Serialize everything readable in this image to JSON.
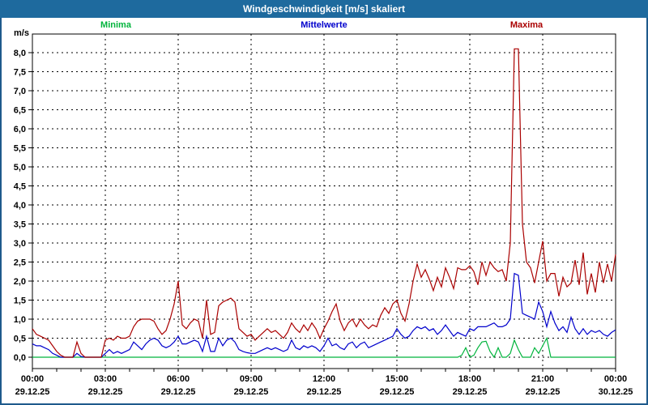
{
  "window": {
    "title": "Windgeschwindigkeit [m/s] skaliert"
  },
  "chart_data": {
    "type": "line",
    "title": "Windgeschwindigkeit [m/s] skaliert",
    "y_unit": "m/s",
    "x_interval_minutes": 10,
    "x_range_hours": [
      0,
      24
    ],
    "ylim": [
      -0.3,
      8.5
    ],
    "y_tick_step": 0.5,
    "grid": true,
    "legend_position": "top",
    "y_tick_labels": [
      "0,0",
      "0,5",
      "1,0",
      "1,5",
      "2,0",
      "2,5",
      "3,0",
      "3,5",
      "4,0",
      "4,5",
      "5,0",
      "5,5",
      "6,0",
      "6,5",
      "7,0",
      "7,5",
      "8,0"
    ],
    "x_ticks": [
      {
        "time": "00:00",
        "date": "29.12.25"
      },
      {
        "time": "03:00",
        "date": "29.12.25"
      },
      {
        "time": "06:00",
        "date": "29.12.25"
      },
      {
        "time": "09:00",
        "date": "29.12.25"
      },
      {
        "time": "12:00",
        "date": "29.12.25"
      },
      {
        "time": "15:00",
        "date": "29.12.25"
      },
      {
        "time": "18:00",
        "date": "29.12.25"
      },
      {
        "time": "21:00",
        "date": "29.12.25"
      },
      {
        "time": "00:00",
        "date": "30.12.25"
      }
    ],
    "series": [
      {
        "name": "Minima",
        "color": "#00b43c",
        "values": [
          0,
          0,
          0,
          0,
          0,
          0,
          0,
          0,
          0,
          0,
          0,
          0,
          0,
          0,
          0,
          0,
          0,
          0,
          0,
          0,
          0,
          0,
          0,
          0,
          0,
          0,
          0,
          0,
          0,
          0,
          0,
          0,
          0,
          0,
          0,
          0,
          0,
          0,
          0,
          0,
          0,
          0,
          0,
          0,
          0,
          0,
          0,
          0,
          0,
          0,
          0,
          0,
          0,
          0,
          0,
          0,
          0,
          0,
          0,
          0,
          0,
          0,
          0,
          0,
          0,
          0,
          0,
          0,
          0,
          0,
          0,
          0,
          0,
          0,
          0,
          0,
          0,
          0,
          0,
          0,
          0,
          0,
          0,
          0,
          0,
          0,
          0,
          0,
          0,
          0,
          0,
          0,
          0,
          0,
          0,
          0,
          0,
          0,
          0,
          0,
          0,
          0,
          0,
          0,
          0,
          0,
          0.05,
          0.25,
          0,
          0.05,
          0.25,
          0.4,
          0.42,
          0.15,
          0,
          0.25,
          0,
          0,
          0.1,
          0.45,
          0.2,
          0,
          0,
          0,
          0.25,
          0.1,
          0.3,
          0.5,
          0,
          0,
          0,
          0,
          0,
          0,
          0,
          0,
          0,
          0,
          0,
          0,
          0,
          0,
          0,
          0,
          0
        ]
      },
      {
        "name": "Mittelwerte",
        "color": "#0000cc",
        "values": [
          0.35,
          0.3,
          0.3,
          0.25,
          0.2,
          0.1,
          0.05,
          0,
          0,
          0,
          0,
          0.1,
          0.02,
          0,
          0,
          0,
          0,
          0,
          0.1,
          0.2,
          0.1,
          0.15,
          0.1,
          0.15,
          0.2,
          0.4,
          0.3,
          0.2,
          0.35,
          0.45,
          0.5,
          0.45,
          0.3,
          0.25,
          0.3,
          0.4,
          0.55,
          0.35,
          0.35,
          0.4,
          0.45,
          0.4,
          0.15,
          0.55,
          0.15,
          0.15,
          0.5,
          0.3,
          0.45,
          0.5,
          0.4,
          0.2,
          0.15,
          0.12,
          0.1,
          0.1,
          0.15,
          0.2,
          0.25,
          0.2,
          0.25,
          0.2,
          0.15,
          0.2,
          0.45,
          0.25,
          0.2,
          0.3,
          0.25,
          0.3,
          0.25,
          0.15,
          0.3,
          0.5,
          0.3,
          0.35,
          0.25,
          0.2,
          0.35,
          0.4,
          0.25,
          0.35,
          0.4,
          0.25,
          0.3,
          0.35,
          0.4,
          0.45,
          0.5,
          0.55,
          0.75,
          0.6,
          0.5,
          0.55,
          0.7,
          0.8,
          0.75,
          0.8,
          0.7,
          0.75,
          0.6,
          0.7,
          0.85,
          0.7,
          0.55,
          0.65,
          0.6,
          0.55,
          0.75,
          0.7,
          0.8,
          0.8,
          0.8,
          0.85,
          0.9,
          0.8,
          0.8,
          0.85,
          1.0,
          2.2,
          2.15,
          1.15,
          1.1,
          1.05,
          1.0,
          1.45,
          1.2,
          0.8,
          1.2,
          0.9,
          0.7,
          0.8,
          0.65,
          1.05,
          0.75,
          0.6,
          0.75,
          0.6,
          0.7,
          0.65,
          0.7,
          0.6,
          0.55,
          0.65,
          0.72
        ]
      },
      {
        "name": "Maxima",
        "color": "#aa0000",
        "values": [
          0.75,
          0.6,
          0.55,
          0.5,
          0.45,
          0.3,
          0.15,
          0.05,
          0,
          0,
          0,
          0.4,
          0.1,
          0,
          0,
          0,
          0,
          0,
          0.45,
          0.5,
          0.45,
          0.55,
          0.5,
          0.5,
          0.55,
          0.8,
          0.95,
          1.0,
          1.0,
          1.0,
          0.95,
          0.75,
          0.6,
          0.7,
          1.0,
          1.4,
          2.0,
          0.85,
          0.75,
          0.9,
          1.0,
          0.95,
          0.5,
          1.5,
          0.6,
          0.65,
          1.35,
          1.45,
          1.5,
          1.55,
          1.45,
          0.75,
          0.65,
          0.55,
          0.6,
          0.45,
          0.55,
          0.65,
          0.75,
          0.65,
          0.7,
          0.6,
          0.5,
          0.65,
          0.9,
          0.75,
          0.65,
          0.85,
          0.7,
          0.9,
          0.75,
          0.5,
          0.75,
          0.95,
          1.2,
          1.4,
          0.95,
          0.7,
          0.9,
          1.0,
          0.8,
          1.0,
          0.85,
          0.75,
          0.85,
          0.8,
          1.1,
          1.3,
          1.15,
          1.4,
          1.5,
          1.15,
          0.95,
          1.4,
          2.0,
          2.45,
          2.1,
          2.3,
          2.05,
          1.75,
          2.1,
          1.85,
          2.35,
          2.1,
          1.8,
          2.35,
          2.3,
          2.3,
          2.4,
          2.25,
          1.9,
          2.5,
          2.15,
          2.5,
          2.35,
          2.25,
          2.3,
          2.0,
          3.0,
          8.1,
          8.1,
          3.5,
          2.5,
          2.35,
          1.95,
          2.5,
          3.05,
          2.0,
          2.2,
          2.2,
          1.6,
          2.1,
          1.85,
          1.95,
          2.55,
          1.9,
          2.75,
          1.65,
          2.2,
          1.7,
          2.5,
          1.95,
          2.45,
          2.0,
          2.7
        ]
      }
    ]
  }
}
